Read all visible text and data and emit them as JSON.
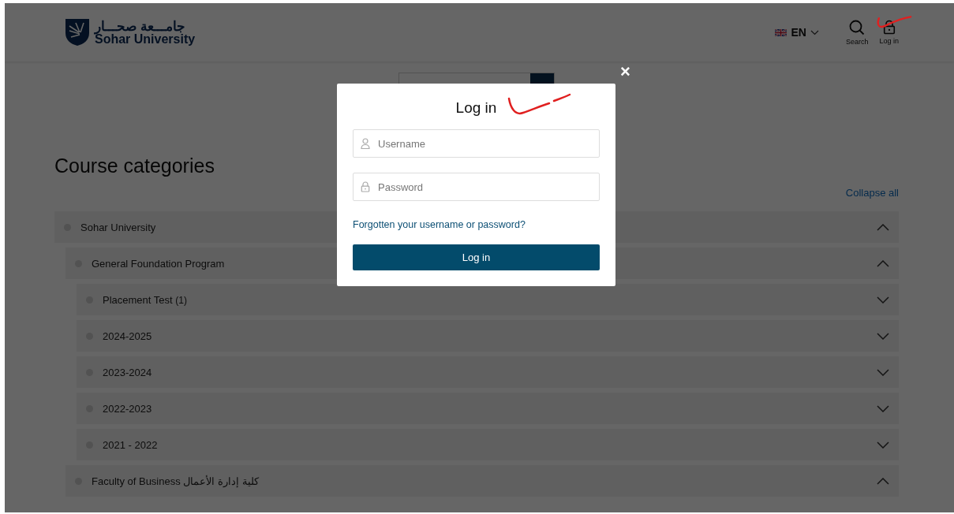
{
  "header": {
    "logo": {
      "arabic_name": "جامـــعة صحـــار",
      "name": "Sohar University"
    },
    "language": {
      "label": "EN"
    },
    "actions": [
      {
        "kind": "search",
        "label": "Search"
      },
      {
        "kind": "lock",
        "label": "Log in"
      }
    ]
  },
  "page": {
    "title": "Course categories",
    "collapse_all": "Collapse all",
    "categories": [
      {
        "label": "Sohar University",
        "expanded": true,
        "children": [
          {
            "label": "General Foundation Program",
            "expanded": true,
            "children": [
              {
                "label": "Placement Test",
                "count": "(1)",
                "expanded": false
              },
              {
                "label": "2024-2025",
                "expanded": false
              },
              {
                "label": "2023-2024",
                "expanded": false
              },
              {
                "label": "2022-2023",
                "expanded": false
              },
              {
                "label": "2021 - 2022",
                "expanded": false
              }
            ]
          },
          {
            "label": "Faculty of Business كلية إدارة الأعمال",
            "expanded": true
          }
        ]
      }
    ]
  },
  "modal": {
    "close": "×",
    "title": "Log in",
    "fields": [
      {
        "kind": "user",
        "placeholder": "Username"
      },
      {
        "kind": "lock",
        "placeholder": "Password"
      }
    ],
    "forgot_link": "Forgotten your username or password?",
    "submit": "Log in"
  }
}
